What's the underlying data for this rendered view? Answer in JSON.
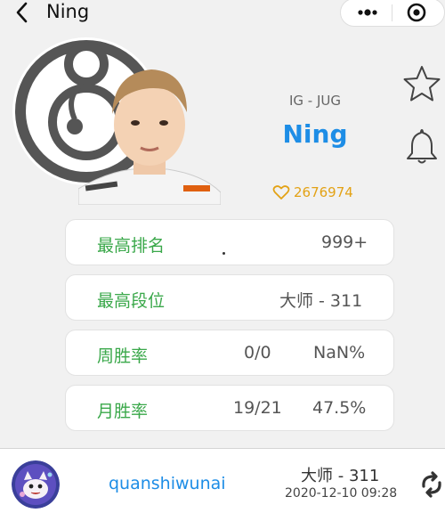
{
  "header": {
    "title": "Ning"
  },
  "profile": {
    "team_role": "IG - JUG",
    "name": "Ning",
    "likes": "2676974"
  },
  "stats": [
    {
      "label": "最高排名",
      "value1": "",
      "value2": "999+"
    },
    {
      "label": "最高段位",
      "value1": "",
      "value2": "大师 - 311"
    },
    {
      "label": "周胜率",
      "value1": "0/0",
      "value2": "NaN%"
    },
    {
      "label": "月胜率",
      "value1": "19/21",
      "value2": "47.5%"
    }
  ],
  "footer": {
    "username": "quanshiwunai",
    "rank": "大师 - 311",
    "time": "2020-12-10 09:28"
  },
  "colors": {
    "accent_blue": "#1d8de6",
    "label_green": "#3aa84a",
    "likes_gold": "#e3a215"
  },
  "icons": [
    "back-icon",
    "more-icon",
    "target-icon",
    "star-icon",
    "bell-icon",
    "heart-icon",
    "refresh-icon"
  ]
}
